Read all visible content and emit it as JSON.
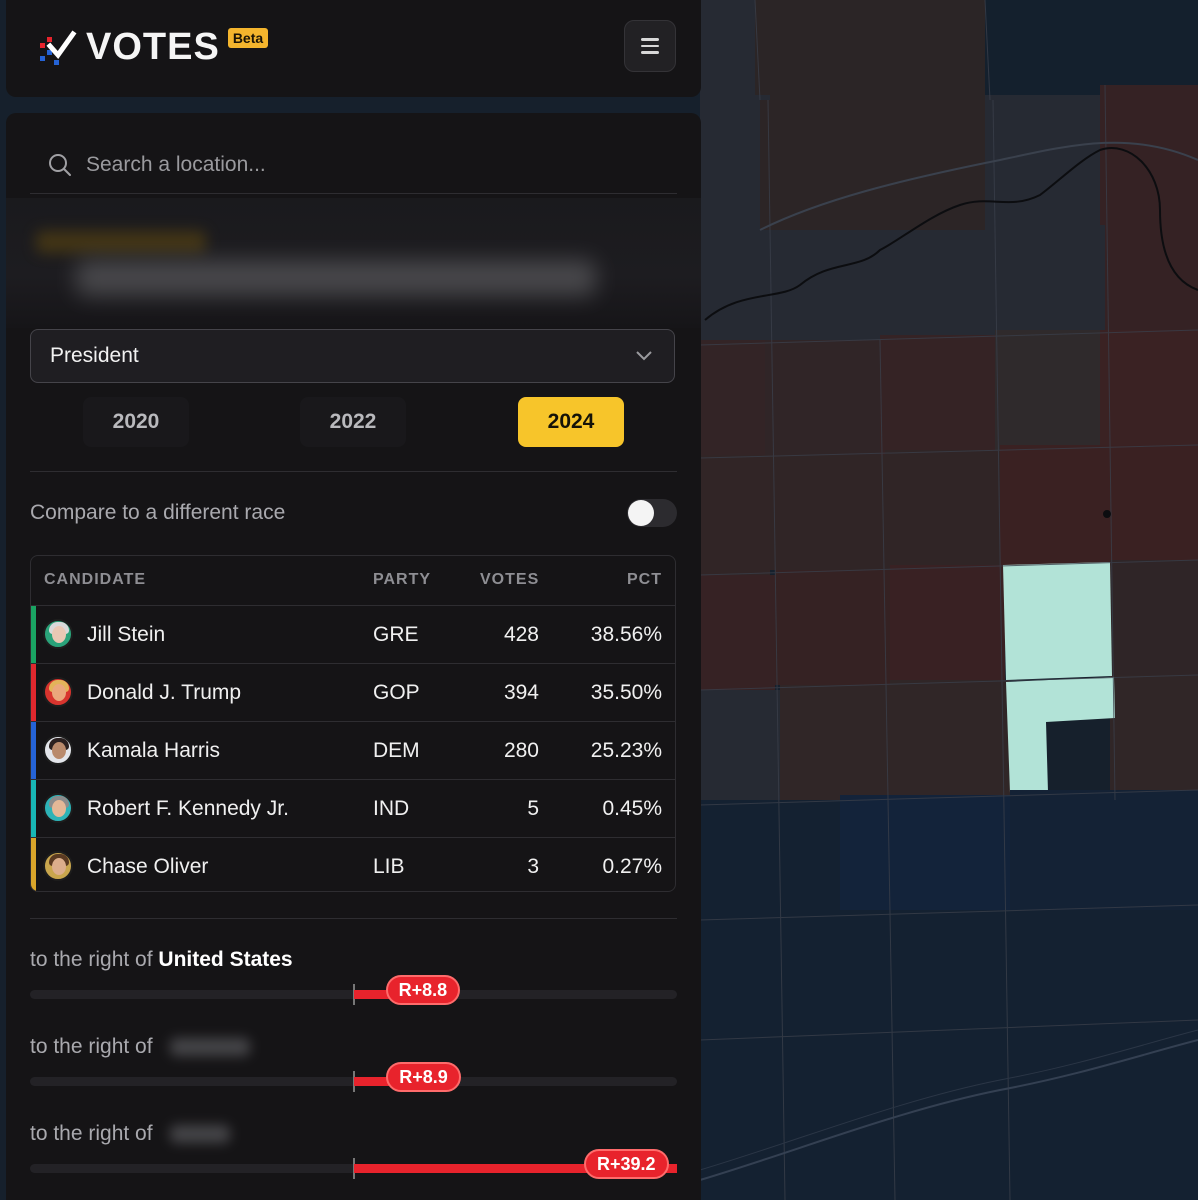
{
  "app": {
    "name": "VOTES",
    "badge": "Beta"
  },
  "header": {
    "menu_icon": "hamburger-menu-icon"
  },
  "search": {
    "placeholder": "Search a location..."
  },
  "race": {
    "selected": "President"
  },
  "years": [
    {
      "label": "2020",
      "active": false
    },
    {
      "label": "2022",
      "active": false
    },
    {
      "label": "2024",
      "active": true
    }
  ],
  "compare": {
    "label": "Compare to a different race",
    "enabled": false
  },
  "table": {
    "headers": {
      "candidate": "CANDIDATE",
      "party": "PARTY",
      "votes": "VOTES",
      "pct": "PCT"
    },
    "rows": [
      {
        "name": "Jill Stein",
        "party": "GRE",
        "votes": "428",
        "pct": "38.56%",
        "color": "#1aa463"
      },
      {
        "name": "Donald J. Trump",
        "party": "GOP",
        "votes": "394",
        "pct": "35.50%",
        "color": "#e0282e"
      },
      {
        "name": "Kamala Harris",
        "party": "DEM",
        "votes": "280",
        "pct": "25.23%",
        "color": "#2563d6"
      },
      {
        "name": "Robert F. Kennedy Jr.",
        "party": "IND",
        "votes": "5",
        "pct": "0.45%",
        "color": "#18b7b5"
      },
      {
        "name": "Chase Oliver",
        "party": "LIB",
        "votes": "3",
        "pct": "0.27%",
        "color": "#d9a52a"
      }
    ]
  },
  "margins": [
    {
      "prefix": "to the right of",
      "place": "United States",
      "value": "R+8.8",
      "fraction": 0.214
    },
    {
      "prefix": "to the right of",
      "place": "",
      "value": "R+8.9",
      "fraction": 0.216
    },
    {
      "prefix": "to the right of",
      "place": "",
      "value": "R+39.2",
      "fraction": 1.0
    }
  ],
  "colors": {
    "accent": "#f7c52a",
    "republican": "#e8232c",
    "highlight_precinct": "#b2e3d7"
  }
}
